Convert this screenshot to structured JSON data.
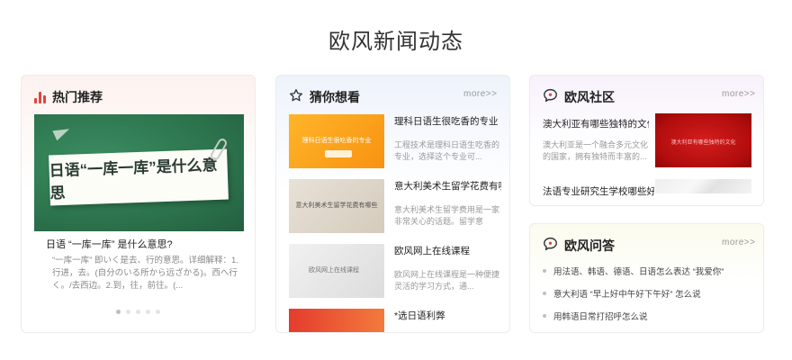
{
  "page": {
    "title": "欧风新闻动态"
  },
  "hot": {
    "title": "热门推荐",
    "slide_text": "日语“一库一库”是什么意思",
    "headline": "日语 “一库一库” 是什么意思?",
    "summary": "“一库一库” 即いく是去、行的意思。详细解释：1.行进，去。(自分のいる所から远ざかる)。西へ行く。/去西边。2.到，往，前往。(...",
    "active_slide": 1,
    "slide_count": 5
  },
  "guess": {
    "title": "猜你想看",
    "more": "more>>",
    "items": [
      {
        "title": "理科日语生很吃香的专业",
        "desc": "工程技术是理科日语生吃香的专业，选择这个专业可...",
        "thumb_caption": "理科日语生很吃香的专业"
      },
      {
        "title": "意大利美术生留学花费有哪些",
        "desc": "意大利美术生留学费用是一家非常关心的话题。留学意",
        "thumb_caption": "意大利美术生留学花费有哪些"
      },
      {
        "title": "欧风网上在线课程",
        "desc": "欧风网上在线课程是一种便捷灵活的学习方式，通...",
        "thumb_caption": "欧风网上在线课程"
      },
      {
        "title": "*选日语利弊",
        "desc": "",
        "thumb_caption": ""
      }
    ]
  },
  "community": {
    "title": "欧风社区",
    "more": "more>>",
    "post1_title": "澳大利亚有哪些独特的文化",
    "post1_desc": "澳大利亚是一个融合多元文化的国家，拥有独特而丰富的...",
    "post1_thumb_caption": "澳大利亚有哪些独特的文化",
    "post2_title": "法语专业研究生学校哪些好"
  },
  "qa": {
    "title": "欧风问答",
    "more": "more>>",
    "items": [
      "用法语、韩语、德语、日语怎么表达 “我爱你”",
      "意大利语 “早上好中午好下午好” 怎么说",
      "用韩语日常打招呼怎么说"
    ]
  },
  "colors": {
    "accent_red": "#e0453c",
    "board_green": "#2e7b52",
    "orange": "#f89212"
  }
}
